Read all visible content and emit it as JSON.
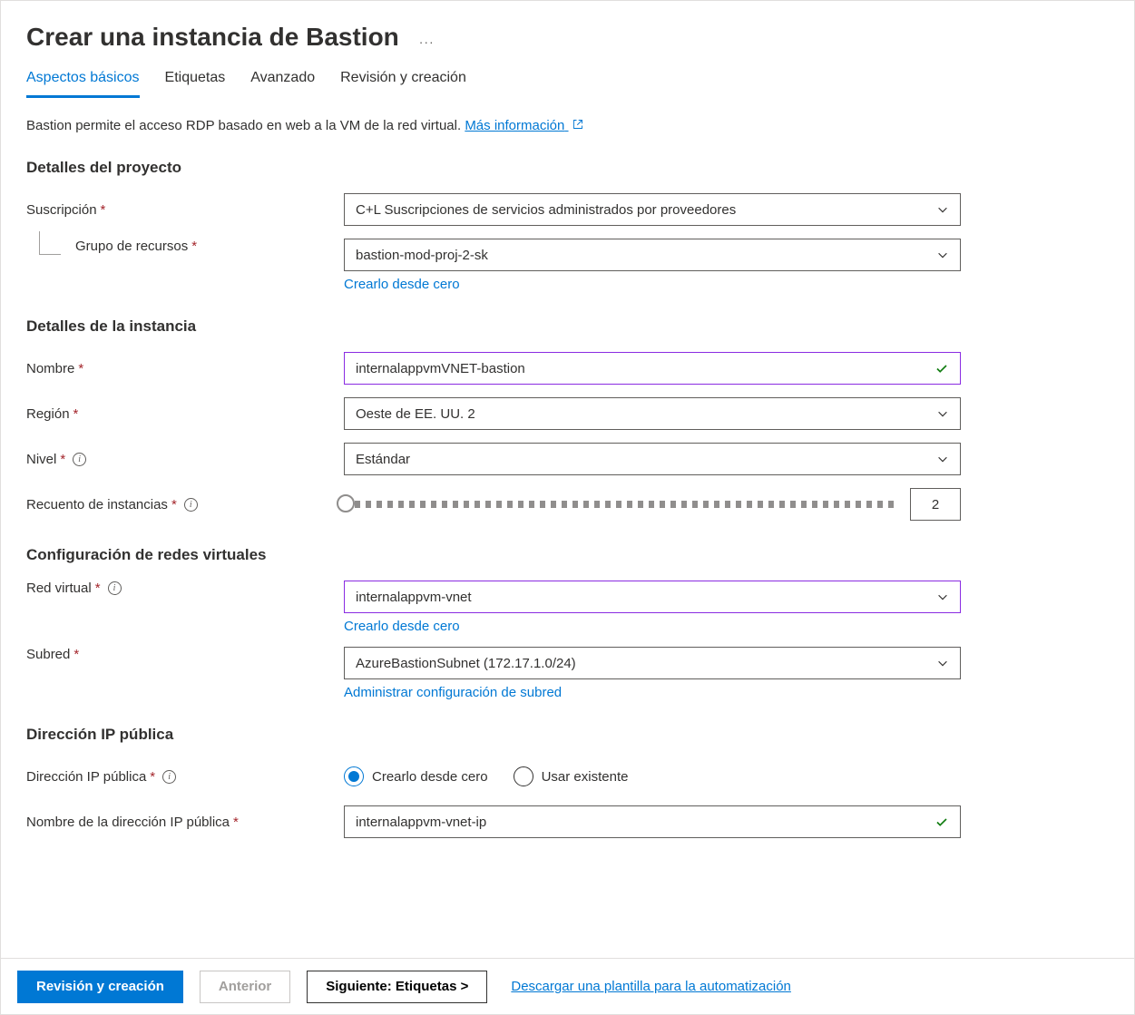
{
  "page": {
    "title": "Crear una instancia de Bastion",
    "intro_text": "Bastion permite el acceso RDP basado en web a la VM de la red virtual. ",
    "intro_link": "Más información"
  },
  "tabs": [
    {
      "label": "Aspectos básicos",
      "active": true
    },
    {
      "label": "Etiquetas",
      "active": false
    },
    {
      "label": "Avanzado",
      "active": false
    },
    {
      "label": "Revisión y creación",
      "active": false
    }
  ],
  "sections": {
    "project": {
      "title": "Detalles del proyecto",
      "subscription": {
        "label": "Suscripción",
        "value": "C+L Suscripciones de servicios administrados por proveedores"
      },
      "resource_group": {
        "label": "Grupo de recursos",
        "value": "bastion-mod-proj-2-sk",
        "create_link": "Crearlo desde cero"
      }
    },
    "instance": {
      "title": "Detalles de la instancia",
      "name": {
        "label": "Nombre",
        "value": "internalappvmVNET-bastion"
      },
      "region": {
        "label": "Región",
        "value": "Oeste de EE. UU. 2"
      },
      "tier": {
        "label": "Nivel",
        "value": "Estándar"
      },
      "instance_count": {
        "label": "Recuento de instancias",
        "value": "2"
      }
    },
    "vnet": {
      "title": "Configuración de redes virtuales",
      "virtual_network": {
        "label": "Red virtual",
        "value": "internalappvm-vnet",
        "create_link": "Crearlo desde cero"
      },
      "subnet": {
        "label": "Subred",
        "value": "AzureBastionSubnet (172.17.1.0/24)",
        "manage_link": "Administrar configuración de subred"
      }
    },
    "public_ip": {
      "title": "Dirección IP pública",
      "public_ip": {
        "label": "Dirección IP pública",
        "opt_create": "Crearlo desde cero",
        "opt_existing": "Usar existente"
      },
      "public_ip_name": {
        "label": "Nombre de la dirección IP pública",
        "value": "internalappvm-vnet-ip"
      }
    }
  },
  "footer": {
    "review_create": "Revisión y creación",
    "previous": "Anterior",
    "next": "Siguiente: Etiquetas >",
    "download_template": "Descargar una plantilla para la automatización"
  }
}
